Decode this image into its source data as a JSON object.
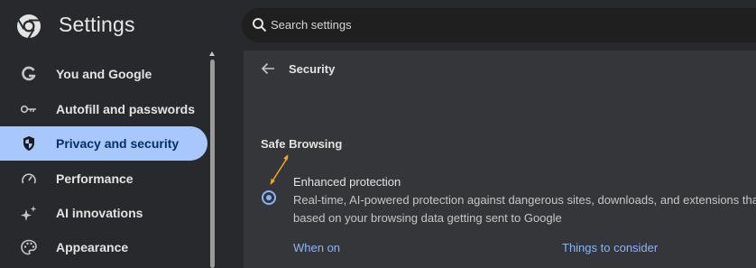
{
  "header": {
    "app_title": "Settings",
    "search_placeholder": "Search settings",
    "logo_icon": "chrome-logo-icon"
  },
  "sidebar": {
    "items": [
      {
        "label": "You and Google",
        "icon": "google-g-icon",
        "active": false
      },
      {
        "label": "Autofill and passwords",
        "icon": "key-icon",
        "active": false
      },
      {
        "label": "Privacy and security",
        "icon": "shield-icon",
        "active": true
      },
      {
        "label": "Performance",
        "icon": "speedometer-icon",
        "active": false
      },
      {
        "label": "AI innovations",
        "icon": "sparkle-icon",
        "active": false
      },
      {
        "label": "Appearance",
        "icon": "palette-icon",
        "active": false
      }
    ]
  },
  "main": {
    "page_title": "Security",
    "section_title": "Safe Browsing",
    "option": {
      "title": "Enhanced protection",
      "desc_line1": "Real-time, AI-powered protection against dangerous sites, downloads, and extensions that's",
      "desc_line2": "based on your browsing data getting sent to Google",
      "selected": true
    },
    "links": {
      "when_on": "When on",
      "things_to_consider": "Things to consider"
    }
  },
  "colors": {
    "background": "#28292d",
    "card": "#35363a",
    "active_nav": "#a8c7fa",
    "link": "#8ab4f8",
    "annotation_arrow": "#f5a623"
  }
}
